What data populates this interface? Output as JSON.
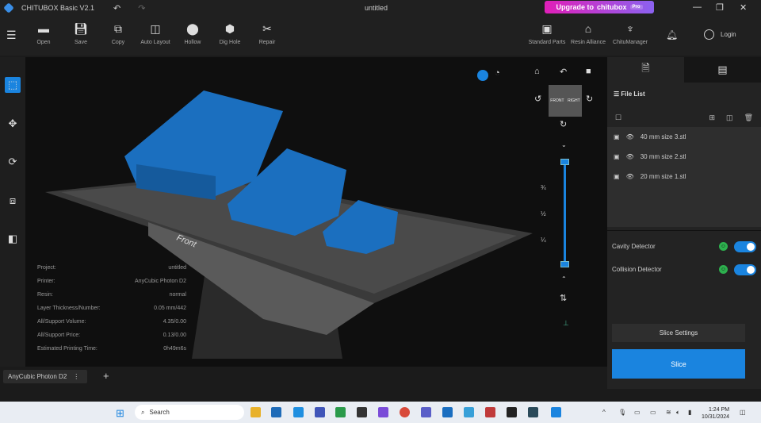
{
  "app": {
    "title": "CHITUBOX Basic V2.1",
    "document": "untitled",
    "upgrade_label": "Upgrade to",
    "upgrade_brand": "chitubox",
    "upgrade_badge": "Pro"
  },
  "toolbar": {
    "items": [
      {
        "label": "Open",
        "icon": "folder-icon"
      },
      {
        "label": "Save",
        "icon": "save-icon"
      },
      {
        "label": "Copy",
        "icon": "copy-icon"
      },
      {
        "label": "Auto Layout",
        "icon": "layout-icon"
      },
      {
        "label": "Hollow",
        "icon": "hollow-icon"
      },
      {
        "label": "Dig Hole",
        "icon": "dig-hole-icon"
      },
      {
        "label": "Repair",
        "icon": "repair-icon"
      }
    ],
    "right_items": [
      {
        "label": "Standard Parts"
      },
      {
        "label": "Resin Alliance"
      },
      {
        "label": "ChituManager"
      }
    ],
    "login": "Login"
  },
  "viewcube": {
    "front": "FRONT",
    "right": "RIGHT"
  },
  "slider": {
    "marks": [
      "¾",
      "½",
      "¼"
    ],
    "top_fraction": 1.0,
    "bottom_fraction": 0.0
  },
  "plate_label": "Front",
  "info": [
    {
      "k": "Project:",
      "v": "untitled"
    },
    {
      "k": "Printer:",
      "v": "AnyCubic Photon D2"
    },
    {
      "k": "Resin:",
      "v": "normal"
    },
    {
      "k": "Layer Thickness/Number:",
      "v": "0.05 mm/442"
    },
    {
      "k": "All/Support Volume:",
      "v": "4.35/0.00"
    },
    {
      "k": "All/Support Price:",
      "v": "0.13/0.00"
    },
    {
      "k": "Estimated Printing Time:",
      "v": "0h49m6s"
    }
  ],
  "file_list": {
    "title": "File List",
    "files": [
      "40 mm size 3.stl",
      "30 mm size 2.stl",
      "20 mm size 1.stl"
    ]
  },
  "detectors": [
    {
      "label": "Cavity Detector",
      "on": true
    },
    {
      "label": "Collision Detector",
      "on": true
    }
  ],
  "slice_settings": "Slice Settings",
  "slice": "Slice",
  "printer_tab": "AnyCubic Photon D2",
  "taskbar": {
    "search": "Search",
    "time": "1:24 PM",
    "date": "10/31/2024"
  },
  "colors": {
    "accent": "#1a84df",
    "model": "#1b6fbf"
  }
}
